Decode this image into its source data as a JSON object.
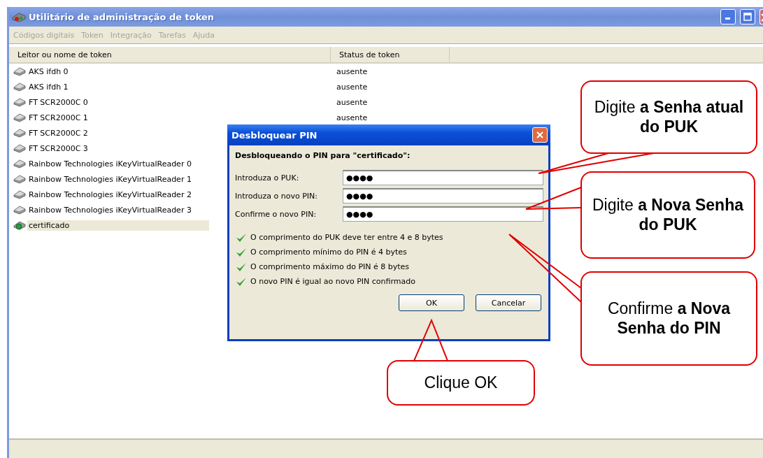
{
  "window": {
    "title": "Utilitário de administração de token"
  },
  "menu": [
    {
      "label": "Códigos digitais",
      "disabled": true
    },
    {
      "label": "Token",
      "disabled": true
    },
    {
      "label": "Integração",
      "disabled": true
    },
    {
      "label": "Tarefas",
      "disabled": true
    },
    {
      "label": "Ajuda",
      "disabled": true
    }
  ],
  "table": {
    "columns": [
      "Leitor ou nome de token",
      "Status de token"
    ],
    "rows": [
      {
        "name": "AKS ifdh 0",
        "status": "ausente",
        "kind": "reader",
        "selected": false
      },
      {
        "name": "AKS ifdh 1",
        "status": "ausente",
        "kind": "reader",
        "selected": false
      },
      {
        "name": "FT SCR2000C 0",
        "status": "ausente",
        "kind": "reader",
        "selected": false
      },
      {
        "name": "FT SCR2000C 1",
        "status": "ausente",
        "kind": "reader",
        "selected": false
      },
      {
        "name": "FT SCR2000C 2",
        "kind": "reader",
        "selected": false
      },
      {
        "name": "FT SCR2000C 3",
        "kind": "reader",
        "selected": false
      },
      {
        "name": "Rainbow Technologies iKeyVirtualReader 0",
        "kind": "reader",
        "selected": false
      },
      {
        "name": "Rainbow Technologies iKeyVirtualReader 1",
        "kind": "reader",
        "selected": false
      },
      {
        "name": "Rainbow Technologies iKeyVirtualReader 2",
        "kind": "reader",
        "selected": false
      },
      {
        "name": "Rainbow Technologies iKeyVirtualReader 3",
        "kind": "reader",
        "selected": false
      },
      {
        "name": "certificado",
        "kind": "token",
        "selected": true
      }
    ]
  },
  "dialog": {
    "title": "Desbloquear PIN",
    "heading": "Desbloqueando o PIN para \"certificado\":",
    "fields": [
      {
        "label": "Introduza o PUK:",
        "value": "●●●●"
      },
      {
        "label": "Introduza o novo PIN:",
        "value": "●●●●"
      },
      {
        "label": "Confirme o novo PIN:",
        "value": "●●●●"
      }
    ],
    "checks": [
      {
        "text": "O comprimento do PUK deve ter entre 4 e 8 bytes",
        "ok": true
      },
      {
        "text": "O comprimento mínimo do PIN é 4 bytes",
        "ok": true
      },
      {
        "text": "O comprimento máximo do PIN é 8 bytes",
        "ok": true
      },
      {
        "text": "O novo PIN é igual ao novo PIN confirmado",
        "ok": true
      }
    ],
    "buttons": [
      "OK",
      "Cancelar"
    ]
  },
  "callouts": [
    {
      "text": "Digite **a Senha atual do PUK**"
    },
    {
      "text": "Digite **a Nova Senha do PUK**"
    },
    {
      "text": "Confirme **a Nova  Senha do PIN**"
    },
    {
      "text": "Clique OK"
    }
  ]
}
